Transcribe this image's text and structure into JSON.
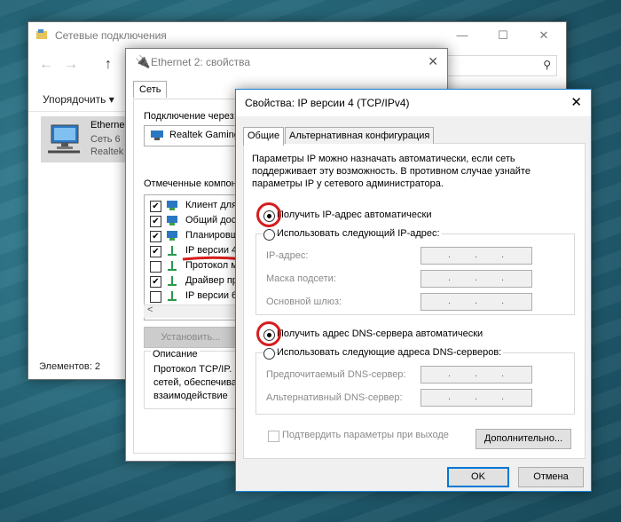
{
  "explorer": {
    "title": "Сетевые подключения",
    "sort_label": "Упорядочить ▾",
    "item": {
      "name": "Etherne",
      "line2": "Сеть 6",
      "line3": "Realtek"
    },
    "status": "Элементов: 2"
  },
  "eth_props": {
    "title": "Ethernet 2: свойства",
    "tab": "Сеть",
    "connect_label": "Подключение через:",
    "adapter": "Realtek Gaming",
    "components_label": "Отмеченные компон",
    "components": [
      {
        "label": "Клиент для",
        "checked": true
      },
      {
        "label": "Общий дост",
        "checked": true
      },
      {
        "label": "Планировщ",
        "checked": true
      },
      {
        "label": "IP версии 4",
        "checked": true
      },
      {
        "label": "Протокол м",
        "checked": false
      },
      {
        "label": "Драйвер про",
        "checked": true
      },
      {
        "label": "IP версии 6",
        "checked": false
      }
    ],
    "install_btn": "Установить...",
    "description_title": "Описание",
    "description_lines": [
      "Протокол TCP/IP.",
      "сетей, обеспечива",
      "взаимодействие"
    ]
  },
  "ipv4": {
    "title": "Свойства: IP версии 4 (TCP/IPv4)",
    "tabs": [
      "Общие",
      "Альтернативная конфигурация"
    ],
    "intro_lines": [
      "Параметры IP можно назначать автоматически, если сеть",
      "поддерживает эту возможность. В противном случае узнайте",
      "параметры IP у сетевого администратора."
    ],
    "ip_auto": "Получить IP-адрес автоматически",
    "ip_manual": "Использовать следующий IP-адрес:",
    "ip_fields": [
      "IP-адрес:",
      "Маска подсети:",
      "Основной шлюз:"
    ],
    "dns_auto": "Получить адрес DNS-сервера автоматически",
    "dns_manual": "Использовать следующие адреса DNS-серверов:",
    "dns_fields": [
      "Предпочитаемый DNS-сервер:",
      "Альтернативный DNS-сервер:"
    ],
    "validate_label": "Подтвердить параметры при выходе",
    "advanced_btn": "Дополнительно...",
    "ok_btn": "OK",
    "cancel_btn": "Отмена"
  }
}
